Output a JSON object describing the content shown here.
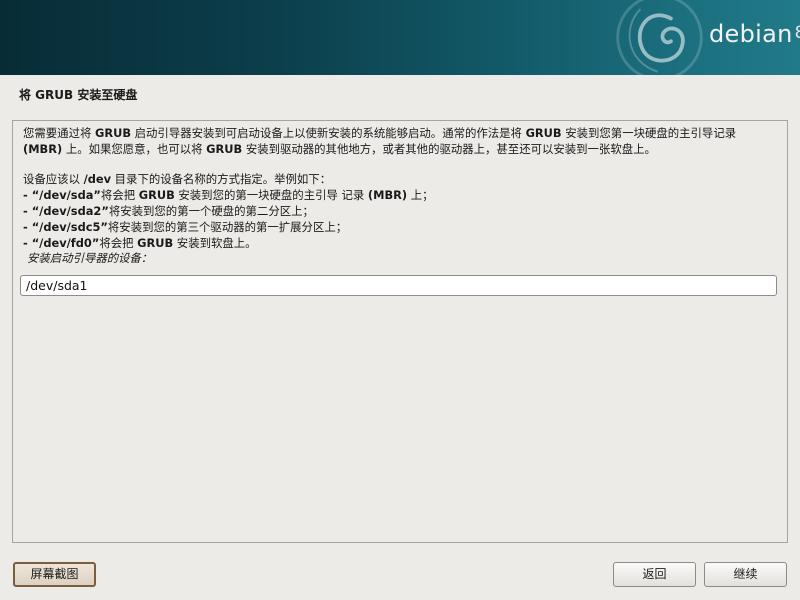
{
  "banner": {
    "logo_text": "debian",
    "logo_version": "8"
  },
  "page": {
    "title": "将 GRUB 安装至硬盘"
  },
  "description": {
    "para1_line1_a": "您需要通过将 ",
    "para1_line1_b": "GRUB",
    "para1_line1_c": " 启动引导器安装到可启动设备上以使新安装的系统能够启动。通常的作法是将 ",
    "para1_line1_d": "GRUB",
    "para1_line1_e": " 安装到您第一块硬盘的主引导记录",
    "para1_line2_a": "(MBR)",
    "para1_line2_b": " 上。如果您愿意，也可以将 ",
    "para1_line2_c": "GRUB",
    "para1_line2_d": " 安装到驱动器的其他地方，或者其他的驱动器上，甚至还可以安装到一张软盘上。",
    "para2_a": "设备应该以 ",
    "para2_b": "/dev",
    "para2_c": " 目录下的设备名称的方式指定。举例如下：",
    "examples": [
      {
        "bold": " - “/dev/sda”",
        "text": "将会把 ",
        "bold2": "GRUB",
        "text2": " 安装到您的第一块硬盘的主引导  记录 ",
        "bold3": "(MBR)",
        "text3": " 上；"
      },
      {
        "bold": " - “/dev/sda2”",
        "text": "将安装到您的第一个硬盘的第二分区上；",
        "bold2": "",
        "text2": "",
        "bold3": "",
        "text3": ""
      },
      {
        "bold": " - “/dev/sdc5”",
        "text": "将安装到您的第三个驱动器的第一扩展分区上；",
        "bold2": "",
        "text2": "",
        "bold3": "",
        "text3": ""
      },
      {
        "bold": " - “/dev/fd0”",
        "text": "将会把 ",
        "bold2": "GRUB",
        "text2": " 安装到软盘上。",
        "bold3": "",
        "text3": ""
      }
    ]
  },
  "device_prompt": {
    "label": "安装启动引导器的设备：",
    "value": "/dev/sda1"
  },
  "buttons": {
    "screenshot": "屏幕截图",
    "back": "返回",
    "continue": "继续"
  },
  "colors": {
    "banner_dark": "#082c36",
    "banner_light": "#217a88",
    "background": "#edebe7",
    "screenshot_border": "#7a5e3e"
  }
}
